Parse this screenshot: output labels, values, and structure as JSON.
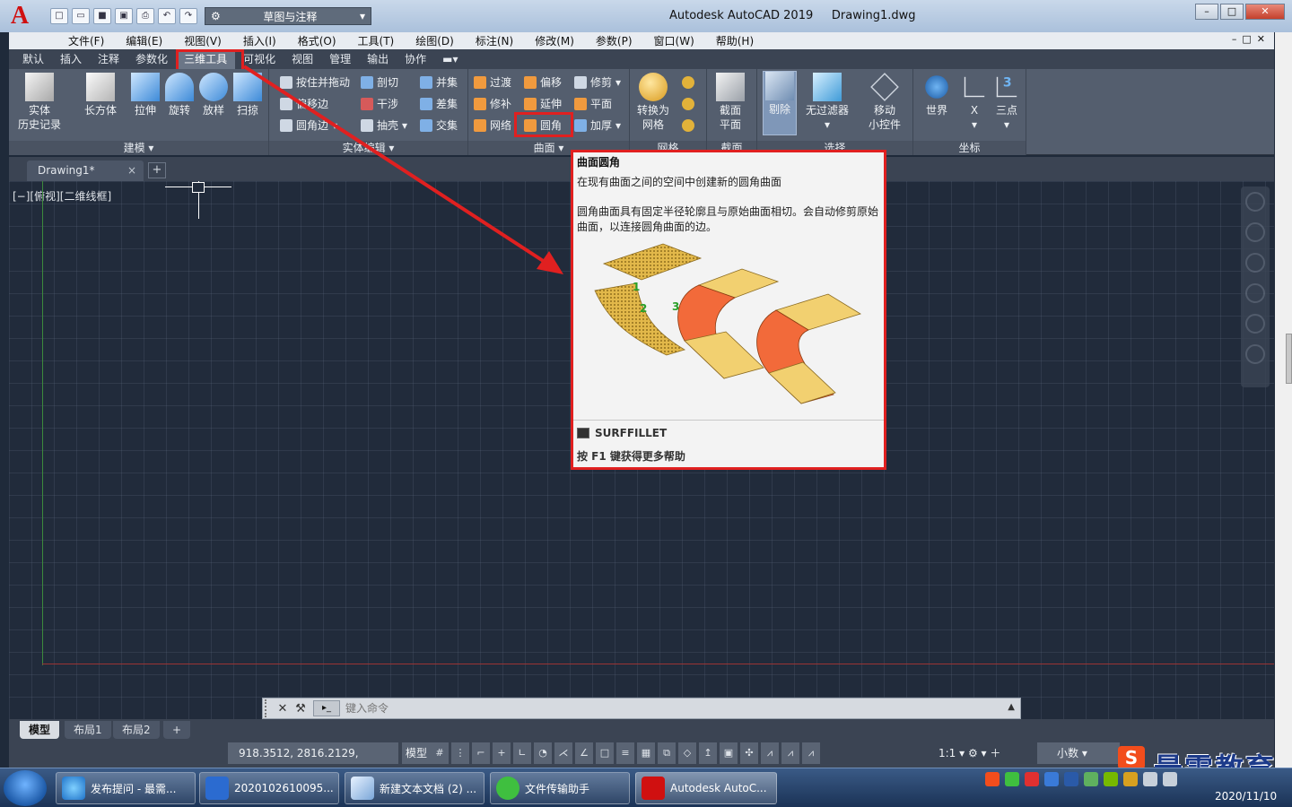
{
  "titlebar": {
    "app_title": "Autodesk AutoCAD 2019",
    "file_name": "Drawing1.dwg",
    "workspace": "草图与注释",
    "logo_letter": "A"
  },
  "menu": [
    "文件(F)",
    "编辑(E)",
    "视图(V)",
    "插入(I)",
    "格式(O)",
    "工具(T)",
    "绘图(D)",
    "标注(N)",
    "修改(M)",
    "参数(P)",
    "窗口(W)",
    "帮助(H)"
  ],
  "ribbon_tabs": [
    "默认",
    "插入",
    "注释",
    "参数化",
    "三维工具",
    "可视化",
    "视图",
    "管理",
    "输出",
    "协作"
  ],
  "active_tab": "三维工具",
  "ribbon": {
    "modeling": {
      "title": "建模",
      "history": "实体\n历史记录",
      "box": "长方体",
      "extrude": "拉伸",
      "revolve": "旋转",
      "loft": "放样",
      "sweep": "扫掠"
    },
    "solid_edit": {
      "title": "实体编辑",
      "presspull": "按住并拖动",
      "offset_edge": "偏移边",
      "fillet_edge": "圆角边",
      "slice": "剖切",
      "interfere": "干涉",
      "shell": "抽壳",
      "union": "并集",
      "subtract": "差集",
      "intersect": "交集"
    },
    "surface": {
      "title": "曲面",
      "blend": "过渡",
      "patch": "修补",
      "network": "网络",
      "offset": "偏移",
      "extend": "延伸",
      "fillet": "圆角",
      "trim": "修剪",
      "planar": "平面",
      "thicken": "加厚"
    },
    "mesh": {
      "convert": "转换为\n网格",
      "title": "网格"
    },
    "section": {
      "plane": "截面\n平面",
      "title": "截面"
    },
    "selection": {
      "cull": "剔除",
      "no_filter": "无过滤器",
      "gizmo": "移动\n小控件",
      "title": "选择"
    },
    "coordinates": {
      "world": "世界",
      "x": "X",
      "three_point": "三点",
      "title": "坐标"
    }
  },
  "file_tab": {
    "name": "Drawing1*",
    "close": "×",
    "add": "+"
  },
  "viewport_label": "[−][俯视][二维线框]",
  "tooltip": {
    "title": "曲面圆角",
    "description": "在现有曲面之间的空间中创建新的圆角曲面",
    "details": "圆角曲面具有固定半径轮廓且与原始曲面相切。会自动修剪原始曲面，以连接圆角曲面的边。",
    "command": "SURFFILLET",
    "help": "按 F1 键获得更多帮助",
    "callouts": [
      "1",
      "2",
      "3"
    ]
  },
  "command_line": {
    "placeholder": "键入命令"
  },
  "layout_tabs": [
    "模型",
    "布局1",
    "布局2"
  ],
  "status": {
    "coordinates": "918.3512, 2816.2129, 0.0000",
    "model": "模型",
    "scale": "1:1",
    "units": "小数"
  },
  "watermark": {
    "logo": "S",
    "text": "最需教育"
  },
  "taskbar": {
    "items": [
      "发布提问 - 最需...",
      "2020102610095...",
      "新建文本文档 (2) ...",
      "文件传输助手",
      "Autodesk AutoC..."
    ],
    "date": "2020/11/10"
  },
  "colors": {
    "highlight_red": "#e02020",
    "ribbon_bg": "#545e6e",
    "canvas_bg": "#212b3b",
    "autocad_red": "#d01010"
  }
}
